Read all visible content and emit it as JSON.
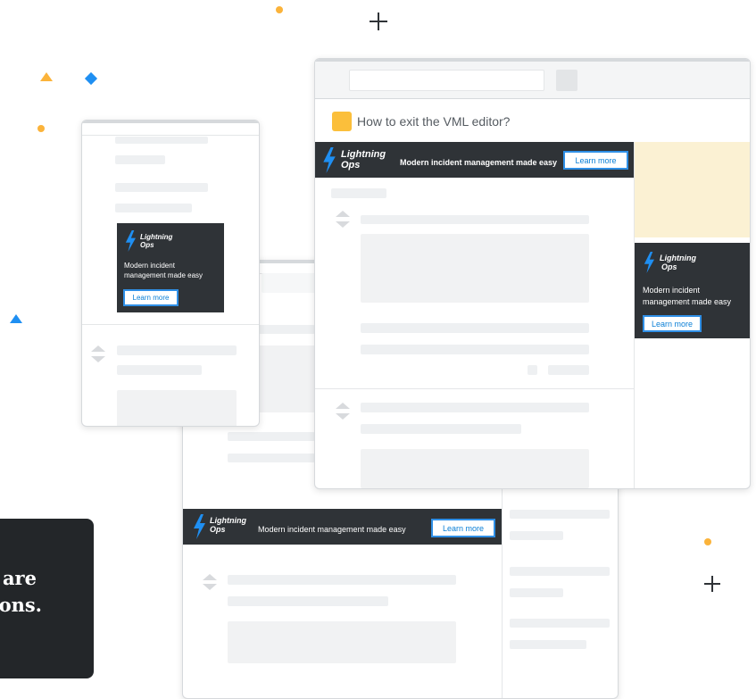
{
  "question": {
    "title": "How to exit the VML editor?"
  },
  "ad": {
    "brand_line1": "Lightning",
    "brand_line2": "Ops",
    "tagline": "Modern incident management made easy",
    "tagline_line1": "Modern incident",
    "tagline_line2": "management made easy",
    "cta": "Learn more"
  },
  "hero": {
    "line1": "are",
    "line2": "ons."
  },
  "colors": {
    "ad_bg": "#2f3337",
    "bolt": "#1f8ff2",
    "accent_yellow": "#fbbf3b",
    "accent_blue": "#1f8ff2",
    "cta_border": "#2f8fe6"
  },
  "icons": [
    "lightning-bolt-icon",
    "plus-icon",
    "upvote-icon",
    "downvote-icon"
  ]
}
